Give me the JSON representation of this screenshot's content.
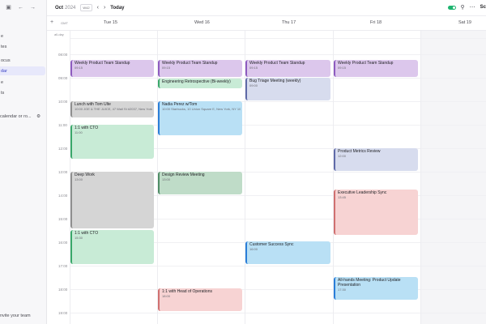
{
  "sidebar": {
    "items": [
      {
        "label": "e"
      },
      {
        "label": "tes"
      },
      {
        "label": "ocus"
      },
      {
        "label": "dar"
      },
      {
        "label": "e"
      },
      {
        "label": "ts"
      }
    ],
    "calendar_label": "calendar or ro...",
    "invite_label": "nvite your team"
  },
  "topbar": {
    "month": "Oct",
    "year": "2024",
    "week_badge": "W42",
    "today_label": "Today",
    "right_label": "Sc"
  },
  "dayheader": {
    "timezone": "GMT",
    "days": [
      {
        "label": "Tue 15"
      },
      {
        "label": "Wed 16"
      },
      {
        "label": "Thu 17"
      },
      {
        "label": "Fri 18"
      },
      {
        "label": "Sat 19"
      }
    ]
  },
  "grid": {
    "allday_label": "all-day",
    "hours": [
      "08:00",
      "09:00",
      "10:00",
      "11:00",
      "12:00",
      "13:00",
      "14:00",
      "15:00",
      "16:00",
      "17:00",
      "18:00",
      "19:00"
    ]
  },
  "events": [
    {
      "title": "Weekly Product Team Standup",
      "time": "09:15",
      "color": "#dcc7ec"
    },
    {
      "title": "Lunch with Tom Ulte",
      "time": "10:00 JOE & THE JUICE, 47 Wall St #2037, New York, NY 10005, USA",
      "color": "#d5d5d5"
    },
    {
      "title": "1:1 with CTO",
      "time": "11:00",
      "color": "#c8ebd6"
    },
    {
      "title": "Deep Work",
      "time": "13:00",
      "color": "#d5d5d5"
    },
    {
      "title": "1:1 with CTO",
      "time": "15:30",
      "color": "#c8ebd6"
    },
    {
      "title": "Weekly Product Team Standup",
      "time": "09:15",
      "color": "#dcc7ec"
    },
    {
      "title": "Engineering Retrospective (Bi-weekly)",
      "time": "",
      "color": "#c8ebd6"
    },
    {
      "title": "Nadia Perez w/Tom",
      "time": "10:00 Starbucks, 10 Union Square E, New York, NY 10003, USA",
      "color": "#b9e0f5"
    },
    {
      "title": "Design Review Meeting",
      "time": "13:00",
      "color": "#bfdcc8"
    },
    {
      "title": "1:1 with Head of Operations",
      "time": "18:00",
      "color": "#f7d3d3"
    },
    {
      "title": "Weekly Product Team Standup",
      "time": "09:15",
      "color": "#dcc7ec"
    },
    {
      "title": "Bug Triage Meeting (weekly)",
      "time": "09:00",
      "color": "#d7dcee"
    },
    {
      "title": "Customer Success Sync",
      "time": "16:00",
      "color": "#b9e0f5"
    },
    {
      "title": "Weekly Product Team Standup",
      "time": "09:15",
      "color": "#dcc7ec"
    },
    {
      "title": "Product Metrics Review",
      "time": "12:00",
      "color": "#d7dcee"
    },
    {
      "title": "Executive Leadership Sync",
      "time": "13:45",
      "color": "#f7d3d3"
    },
    {
      "title": "All-hands Meeting: Product Update Presentation",
      "time": "17:30",
      "color": "#b9e0f5"
    }
  ],
  "colors": {
    "accent": "#6c7cff",
    "toggle_on": "#1db46f"
  },
  "icons": [
    "sidebar-toggle-icon",
    "back-arrow-icon",
    "forward-arrow-icon",
    "plus-icon",
    "chevron-left-icon",
    "chevron-right-icon",
    "search-icon",
    "more-icon",
    "settings-icon"
  ]
}
